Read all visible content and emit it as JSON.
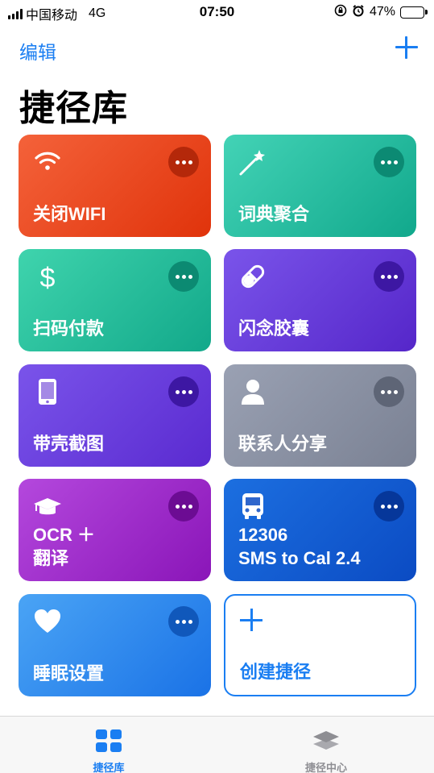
{
  "status_bar": {
    "carrier": "中国移动",
    "network": "4G",
    "time": "07:50",
    "battery_percent": "47%",
    "battery_level": 0.47
  },
  "nav": {
    "edit_label": "编辑",
    "title": "捷径库"
  },
  "shortcuts": [
    {
      "label": "关闭WIFI",
      "icon": "wifi-icon",
      "color_start": "#f4623a",
      "color_end": "#e0330b",
      "more_bg": "#b4280a"
    },
    {
      "label": "词典聚合",
      "icon": "magic-wand-icon",
      "color_start": "#43d3b6",
      "color_end": "#11a88c",
      "more_bg": "#0c8a73"
    },
    {
      "label": "扫码付款",
      "icon": "dollar-icon",
      "color_start": "#3fd4ad",
      "color_end": "#12a88a",
      "more_bg": "#0c8a72"
    },
    {
      "label": "闪念胶囊",
      "icon": "pill-icon",
      "color_start": "#7a54ea",
      "color_end": "#5526c9",
      "more_bg": "#3d17a3"
    },
    {
      "label": "带壳截图",
      "icon": "phone-icon",
      "color_start": "#7a54ea",
      "color_end": "#5a2ad0",
      "more_bg": "#3d17a3"
    },
    {
      "label": "联系人分享",
      "icon": "person-icon",
      "color_start": "#9aa1b3",
      "color_end": "#7a8193",
      "more_bg": "#5e6576"
    },
    {
      "label": "OCR ＋\n翻译",
      "icon": "graduation-cap-icon",
      "color_start": "#b448dd",
      "color_end": "#8a15b8",
      "more_bg": "#6c0c93"
    },
    {
      "label": "12306\nSMS to Cal 2.4",
      "icon": "bus-icon",
      "color_start": "#1c6fe0",
      "color_end": "#0b4bc3",
      "more_bg": "#06379a"
    },
    {
      "label": "睡眠设置",
      "icon": "heart-icon",
      "color_start": "#4aa4f5",
      "color_end": "#1a72e6",
      "more_bg": "#1058bb"
    }
  ],
  "create_tile": {
    "label": "创建捷径"
  },
  "tab_bar": {
    "tabs": [
      {
        "label": "捷径库",
        "icon": "grid-icon",
        "active": true,
        "color": "#1a7ef2"
      },
      {
        "label": "捷径中心",
        "icon": "layers-icon",
        "active": false,
        "color": "#8e8e93"
      }
    ]
  },
  "accent_color": "#1a7ef2"
}
